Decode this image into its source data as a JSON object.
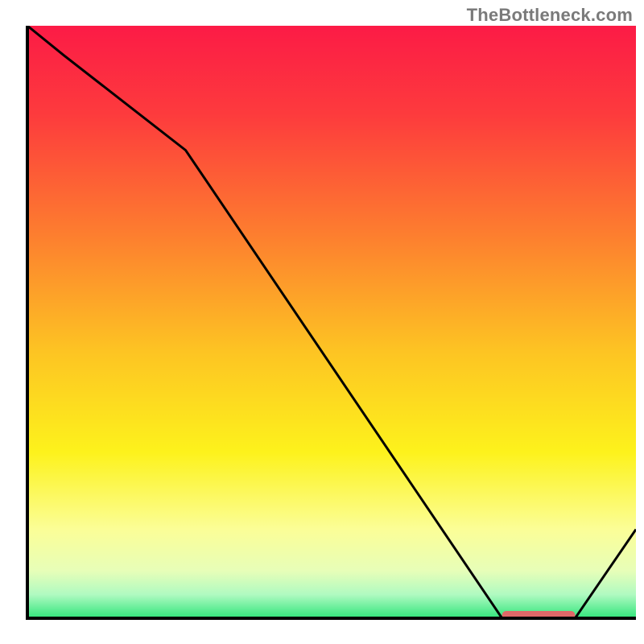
{
  "attribution": "TheBottleneck.com",
  "chart_data": {
    "type": "line",
    "title": "",
    "xlabel": "",
    "ylabel": "",
    "xlim": [
      0,
      100
    ],
    "ylim": [
      0,
      100
    ],
    "x": [
      0,
      6,
      26,
      78,
      81,
      90,
      100
    ],
    "values": [
      100,
      95,
      79,
      0,
      0,
      0,
      15
    ],
    "marker": {
      "x_start": 78,
      "x_end": 90,
      "y": 0,
      "color": "#e06868"
    },
    "gradient_stops": [
      {
        "offset": 0,
        "color": "#fc1b46"
      },
      {
        "offset": 0.15,
        "color": "#fd3b3d"
      },
      {
        "offset": 0.35,
        "color": "#fd7d2f"
      },
      {
        "offset": 0.55,
        "color": "#fdc423"
      },
      {
        "offset": 0.72,
        "color": "#fdf21c"
      },
      {
        "offset": 0.85,
        "color": "#fbfe97"
      },
      {
        "offset": 0.92,
        "color": "#e7feb8"
      },
      {
        "offset": 0.96,
        "color": "#b0fac1"
      },
      {
        "offset": 1.0,
        "color": "#31e57b"
      }
    ],
    "axis_color": "#000000",
    "line_color": "#000000"
  }
}
